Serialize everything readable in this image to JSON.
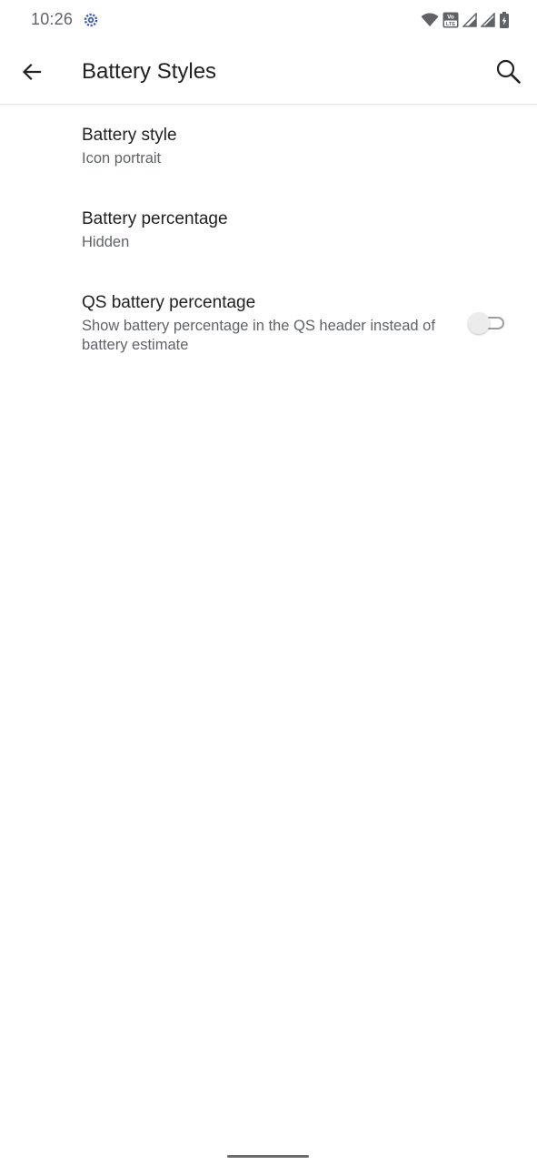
{
  "status_bar": {
    "time": "10:26",
    "volte_label": "Vo LTE",
    "icons": [
      "settings-gear-notification-icon",
      "wifi-icon",
      "volte-icon",
      "signal-icon",
      "signal-icon",
      "battery-charging-icon"
    ]
  },
  "app_bar": {
    "title": "Battery Styles",
    "back_icon": "arrow-back-icon",
    "search_icon": "search-icon"
  },
  "preferences": [
    {
      "title": "Battery style",
      "summary": "Icon portrait"
    },
    {
      "title": "Battery percentage",
      "summary": "Hidden"
    },
    {
      "title": "QS battery percentage",
      "summary": "Show battery percentage in the QS header instead of battery estimate",
      "toggle_checked": false
    }
  ],
  "colors": {
    "primary_text": "#202124",
    "secondary_text": "#5f6368",
    "accent_app_icon": "#3b5bb5"
  }
}
